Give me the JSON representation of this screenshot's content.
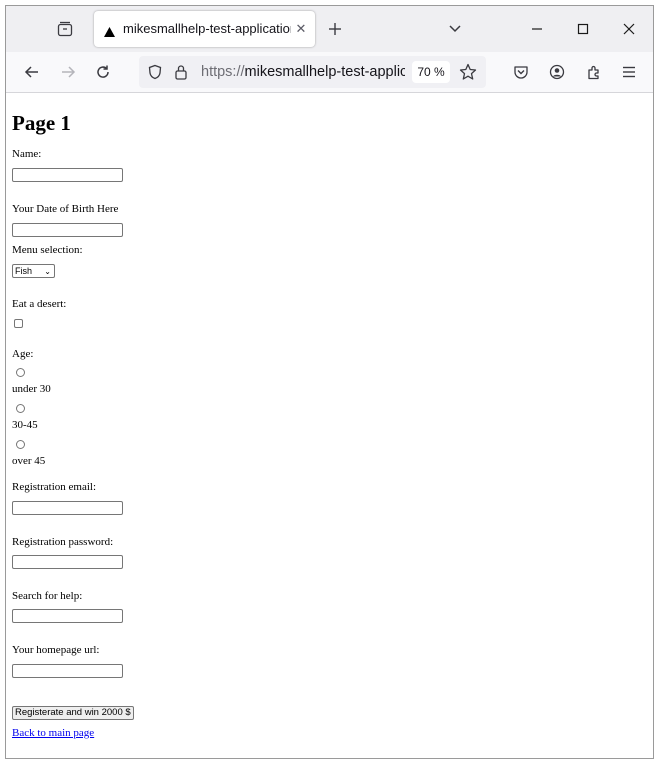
{
  "browser": {
    "tab": {
      "title": "mikesmallhelp-test-application",
      "favicon": "triangle-icon"
    },
    "address_bar": {
      "scheme": "https://",
      "url_rest": "mikesmallhelp-test-application",
      "zoom": "70 %"
    },
    "icons": [
      "tab-list-icon",
      "new-tab-icon",
      "tabs-overflow-icon",
      "minimize-icon",
      "maximize-icon",
      "close-icon",
      "back-icon",
      "forward-icon",
      "reload-icon",
      "shield-icon",
      "lock-icon",
      "bookmark-star-icon",
      "pocket-icon",
      "account-icon",
      "extensions-icon",
      "menu-icon"
    ]
  },
  "page": {
    "heading": "Page 1",
    "fields": {
      "name_label": "Name:",
      "name_value": "",
      "dob_label": "Your Date of Birth Here",
      "dob_value": "",
      "menu_label": "Menu selection:",
      "menu_selected": "Fish",
      "dessert_label": "Eat a desert:",
      "age_label": "Age:",
      "age_options": [
        "under 30",
        "30-45",
        "over 45"
      ],
      "email_label": "Registration email:",
      "email_value": "",
      "password_label": "Registration password:",
      "password_value": "",
      "search_label": "Search for help:",
      "search_value": "",
      "homepage_label": "Your homepage url:",
      "homepage_value": ""
    },
    "submit_label": "Registerate and win 2000 $",
    "back_link": "Back to main page"
  }
}
